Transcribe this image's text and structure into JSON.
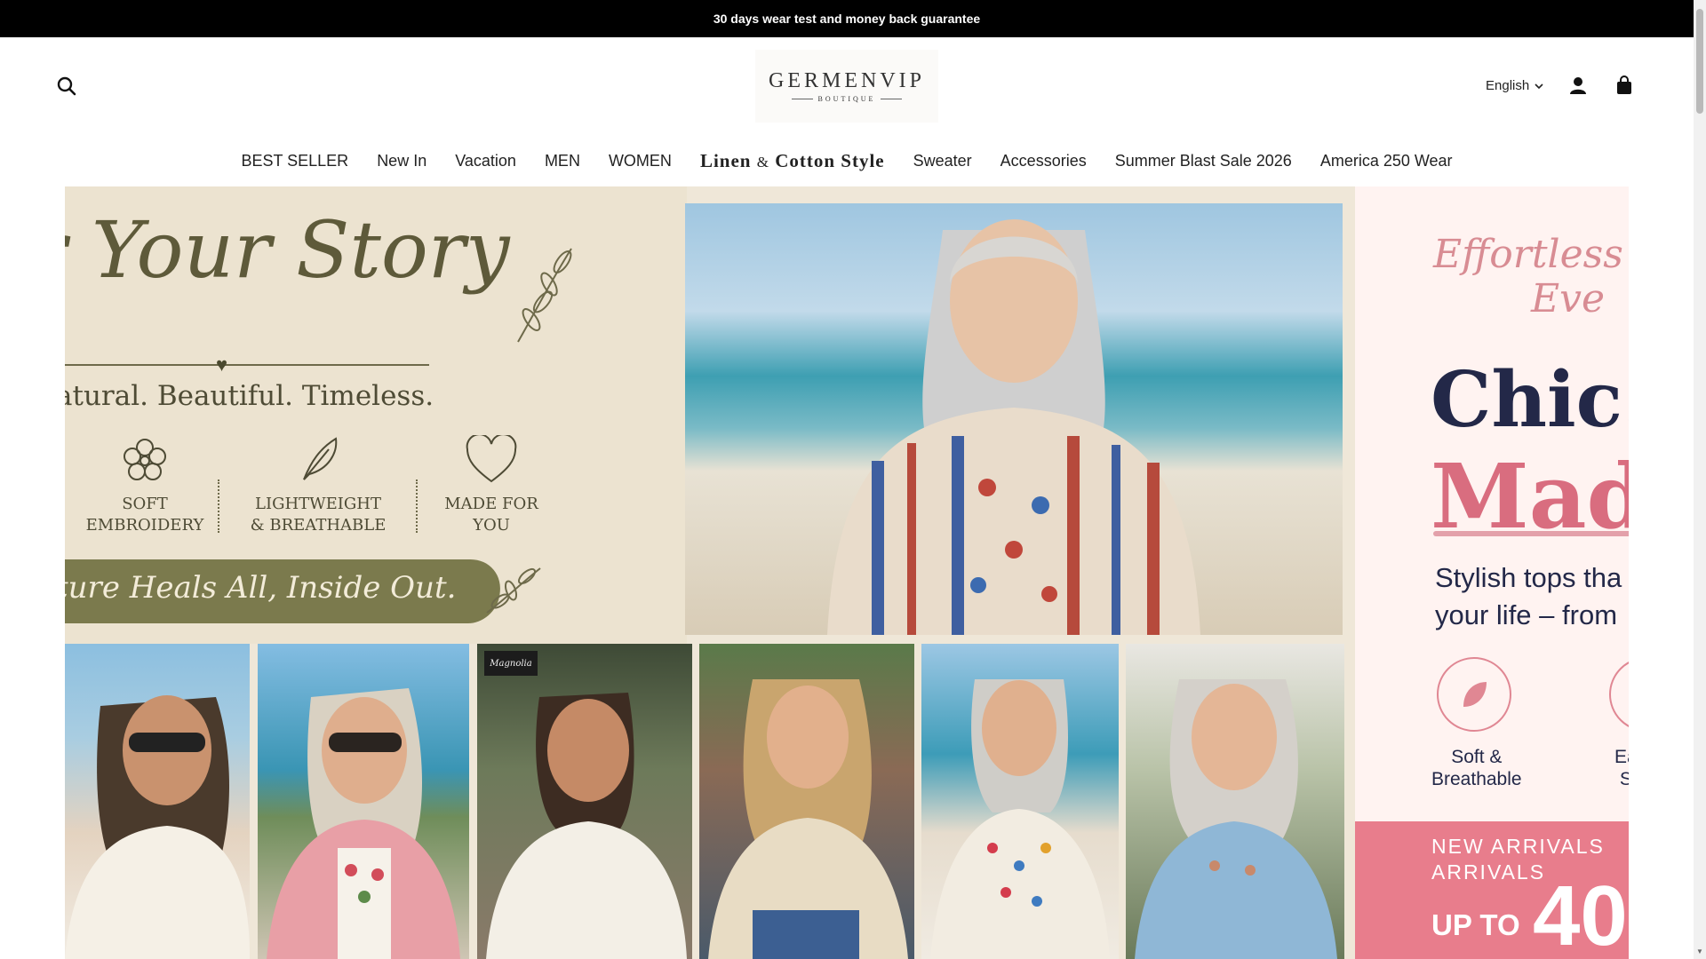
{
  "announcement": "30 days wear test and money back guarantee",
  "header": {
    "logo_main": "GERMENVIP",
    "logo_sub": "BOUTIQUE",
    "language": "English"
  },
  "nav": {
    "items": [
      "BEST SELLER",
      "New In",
      "Vacation",
      "MEN",
      "WOMEN",
      "Linen",
      "&",
      "Cotton Style",
      "Sweater",
      "Accessories",
      "Summer Blast Sale 2026",
      "America 250 Wear"
    ]
  },
  "hero": {
    "left": {
      "script_title": "r Your Story",
      "tagline": "atural. Beautiful. Timeless.",
      "features": [
        {
          "l1": "SOFT",
          "l2": "EMBROIDERY"
        },
        {
          "l1": "LIGHTWEIGHT",
          "l2": "& BREATHABLE"
        },
        {
          "l1": "MADE FOR",
          "l2": "YOU"
        }
      ],
      "banner_script": "ture Heals All, Inside Out."
    },
    "right": {
      "script_l1": "Effortless S",
      "script_l2": "Eve",
      "chic": "Chic.",
      "made": "Made",
      "copy_l1": "Stylish tops tha",
      "copy_l2": "your life – from",
      "feat1_l1": "Soft &",
      "feat1_l2": "Breathable",
      "feat2_l1": "Ea",
      "feat2_l2": "S",
      "band_l1": "NEW ARRIVALS",
      "band_l2": "ARRIVALS",
      "band_upto": "UP TO",
      "band_big": "40"
    },
    "photo_sign": "Magnolia"
  },
  "colors": {
    "announcement_bg": "#000000",
    "panel_olive": "#7b7a4d",
    "navy": "#232848",
    "pink": "#d96d7f"
  },
  "icons": [
    "search-icon",
    "account-icon",
    "cart-icon",
    "chevron-down-icon",
    "flower-icon",
    "feather-icon",
    "heart-icon",
    "leaf-icon"
  ]
}
